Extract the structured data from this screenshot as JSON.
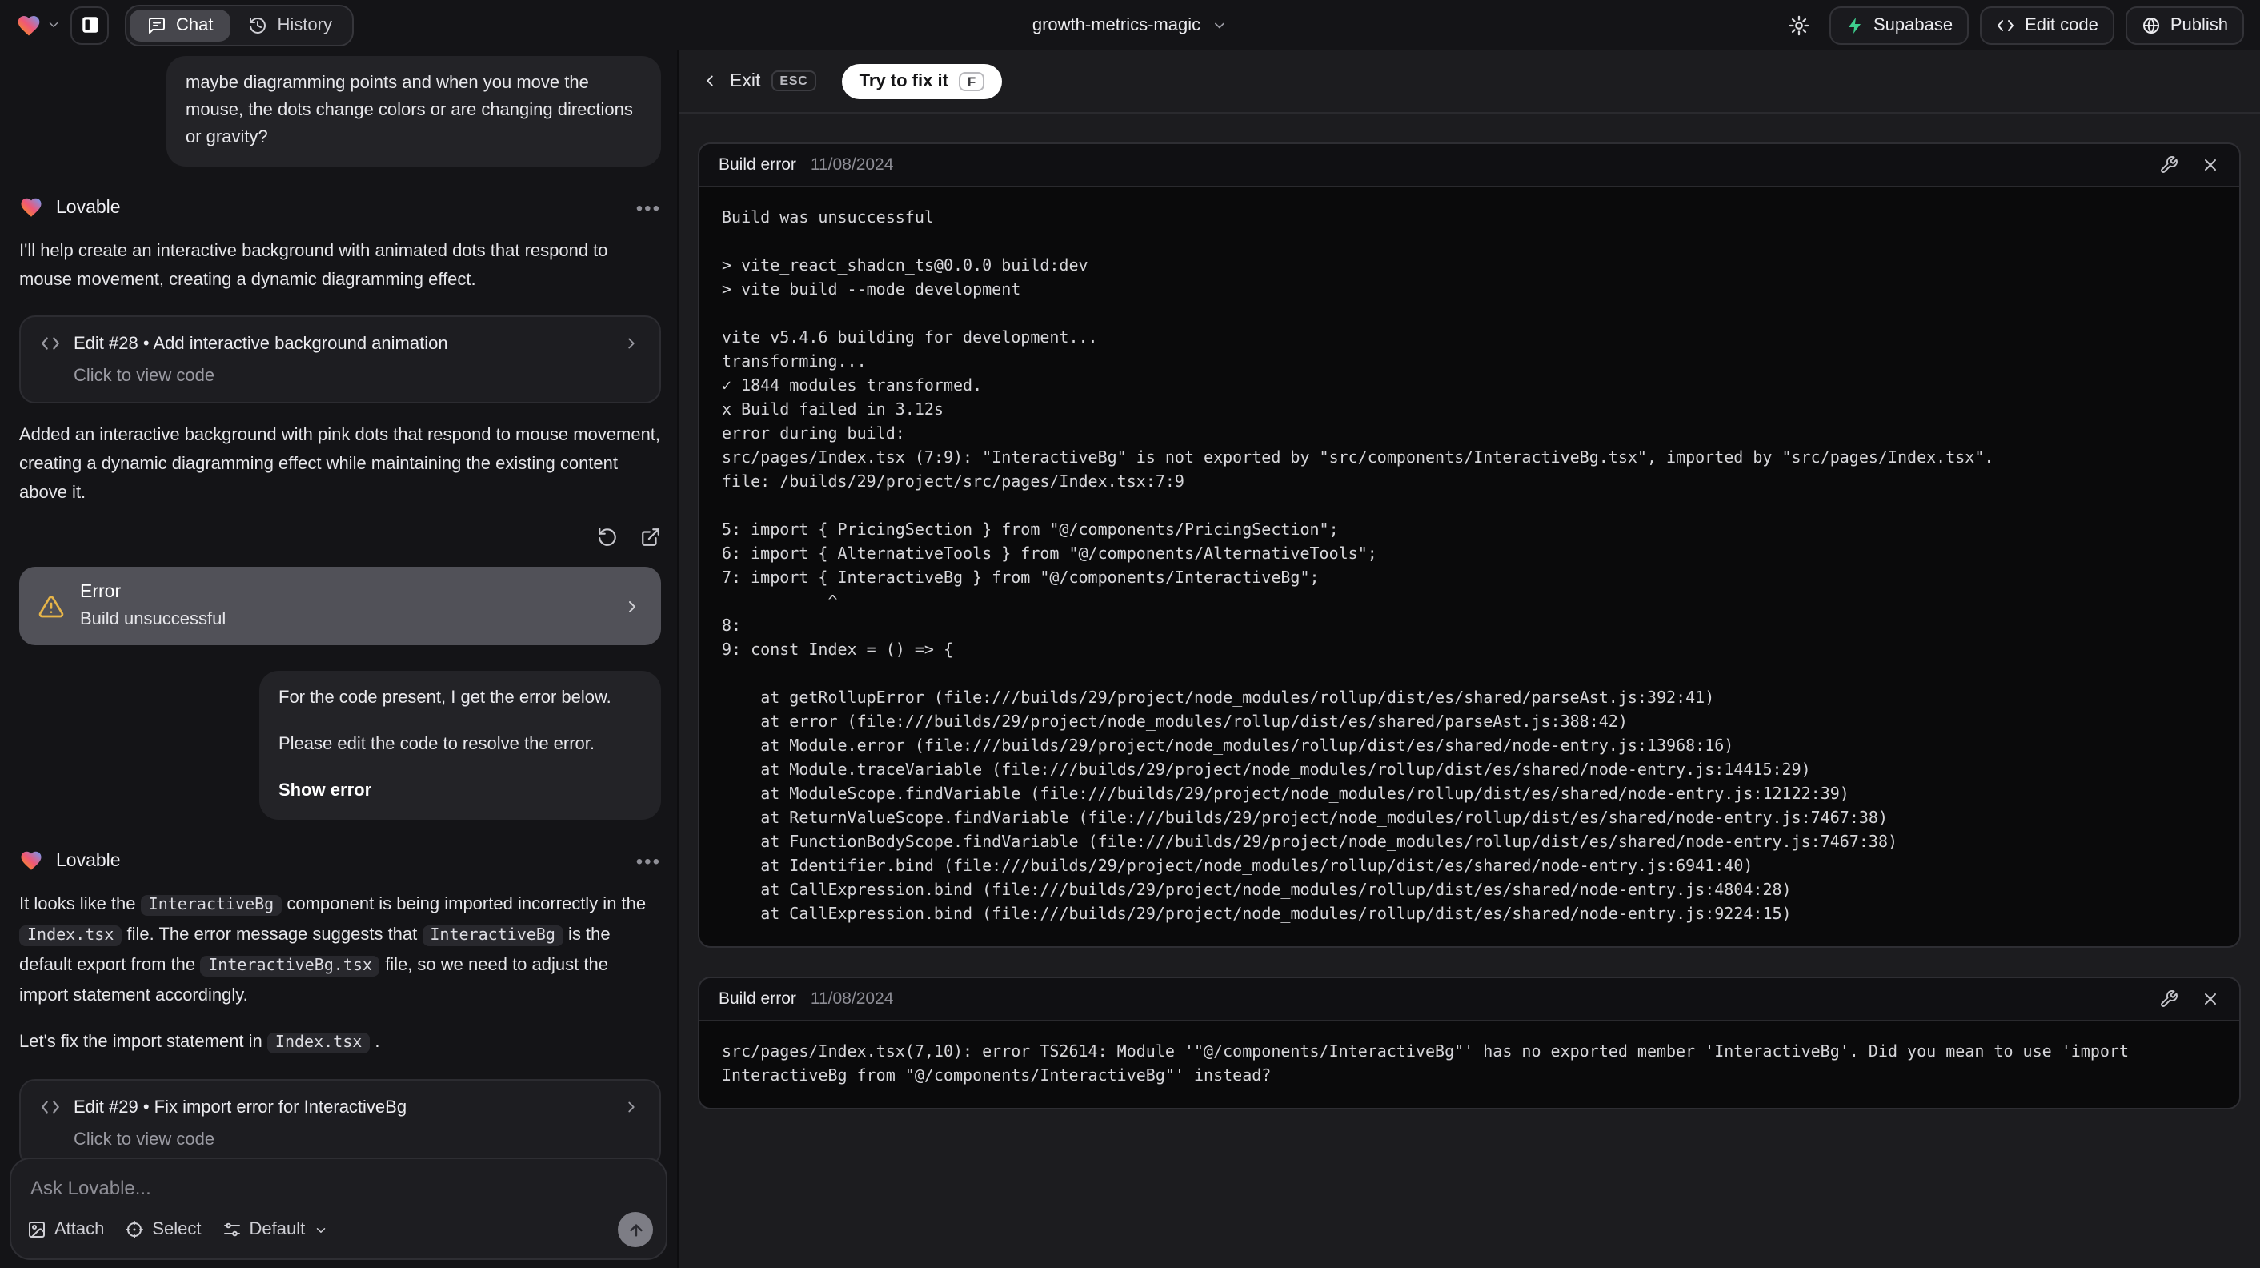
{
  "topbar": {
    "project_name": "growth-metrics-magic",
    "tabs": [
      {
        "label": "Chat"
      },
      {
        "label": "History"
      }
    ],
    "actions": {
      "supabase": "Supabase",
      "edit_code": "Edit code",
      "publish": "Publish"
    },
    "colors": {
      "supabase_green": "#3ecf8e"
    }
  },
  "chat": {
    "assistant_name": "Lovable",
    "user_message_1": "maybe diagramming points and when you move the mouse, the dots change colors or are changing directions or gravity?",
    "assistant_msg_1": "I'll help create an interactive background with animated dots that respond to mouse movement, creating a dynamic diagramming effect.",
    "edit28": {
      "title": "Edit #28 • Add interactive background animation",
      "subtitle": "Click to view code"
    },
    "assistant_msg_2": "Added an interactive background with pink dots that respond to mouse movement, creating a dynamic diagramming effect while maintaining the existing content above it.",
    "error_banner": {
      "title": "Error",
      "subtitle": "Build unsuccessful",
      "warning_color": "#e7b549"
    },
    "user_message_2_p1": "For the code present, I get the error below.",
    "user_message_2_p2": "Please edit the code to resolve the error.",
    "show_error_label": "Show error",
    "assistant_msg_3_parts": [
      {
        "t": "text",
        "v": "It looks like the "
      },
      {
        "t": "code",
        "v": "InteractiveBg"
      },
      {
        "t": "text",
        "v": " component is being imported incorrectly in the "
      },
      {
        "t": "code",
        "v": "Index.tsx"
      },
      {
        "t": "text",
        "v": " file. The error message suggests that "
      },
      {
        "t": "code",
        "v": "InteractiveBg"
      },
      {
        "t": "text",
        "v": " is the default export from the "
      },
      {
        "t": "code",
        "v": "InteractiveBg.tsx"
      },
      {
        "t": "text",
        "v": " file, so we need to adjust the import statement accordingly."
      }
    ],
    "assistant_msg_4_parts": [
      {
        "t": "text",
        "v": "Let's fix the import statement in "
      },
      {
        "t": "code",
        "v": "Index.tsx"
      },
      {
        "t": "text",
        "v": " ."
      }
    ],
    "edit29": {
      "title": "Edit #29 • Fix import error for InteractiveBg",
      "subtitle": "Click to view code"
    },
    "input": {
      "placeholder": "Ask Lovable...",
      "attach": "Attach",
      "select": "Select",
      "mode": "Default"
    }
  },
  "panel": {
    "exit_label": "Exit",
    "exit_kbd": "ESC",
    "fix_label": "Try to fix it",
    "fix_kbd": "F",
    "cards": [
      {
        "title": "Build error",
        "date": "11/08/2024",
        "log": "Build was unsuccessful\n\n> vite_react_shadcn_ts@0.0.0 build:dev\n> vite build --mode development\n\nvite v5.4.6 building for development...\ntransforming...\n✓ 1844 modules transformed.\nx Build failed in 3.12s\nerror during build:\nsrc/pages/Index.tsx (7:9): \"InteractiveBg\" is not exported by \"src/components/InteractiveBg.tsx\", imported by \"src/pages/Index.tsx\".\nfile: /builds/29/project/src/pages/Index.tsx:7:9\n\n5: import { PricingSection } from \"@/components/PricingSection\";\n6: import { AlternativeTools } from \"@/components/AlternativeTools\";\n7: import { InteractiveBg } from \"@/components/InteractiveBg\";\n           ^\n8:\n9: const Index = () => {\n\n    at getRollupError (file:///builds/29/project/node_modules/rollup/dist/es/shared/parseAst.js:392:41)\n    at error (file:///builds/29/project/node_modules/rollup/dist/es/shared/parseAst.js:388:42)\n    at Module.error (file:///builds/29/project/node_modules/rollup/dist/es/shared/node-entry.js:13968:16)\n    at Module.traceVariable (file:///builds/29/project/node_modules/rollup/dist/es/shared/node-entry.js:14415:29)\n    at ModuleScope.findVariable (file:///builds/29/project/node_modules/rollup/dist/es/shared/node-entry.js:12122:39)\n    at ReturnValueScope.findVariable (file:///builds/29/project/node_modules/rollup/dist/es/shared/node-entry.js:7467:38)\n    at FunctionBodyScope.findVariable (file:///builds/29/project/node_modules/rollup/dist/es/shared/node-entry.js:7467:38)\n    at Identifier.bind (file:///builds/29/project/node_modules/rollup/dist/es/shared/node-entry.js:6941:40)\n    at CallExpression.bind (file:///builds/29/project/node_modules/rollup/dist/es/shared/node-entry.js:4804:28)\n    at CallExpression.bind (file:///builds/29/project/node_modules/rollup/dist/es/shared/node-entry.js:9224:15)"
      },
      {
        "title": "Build error",
        "date": "11/08/2024",
        "log": "src/pages/Index.tsx(7,10): error TS2614: Module '\"@/components/InteractiveBg\"' has no exported member 'InteractiveBg'. Did you mean to use 'import InteractiveBg from \"@/components/InteractiveBg\"' instead?"
      }
    ]
  }
}
